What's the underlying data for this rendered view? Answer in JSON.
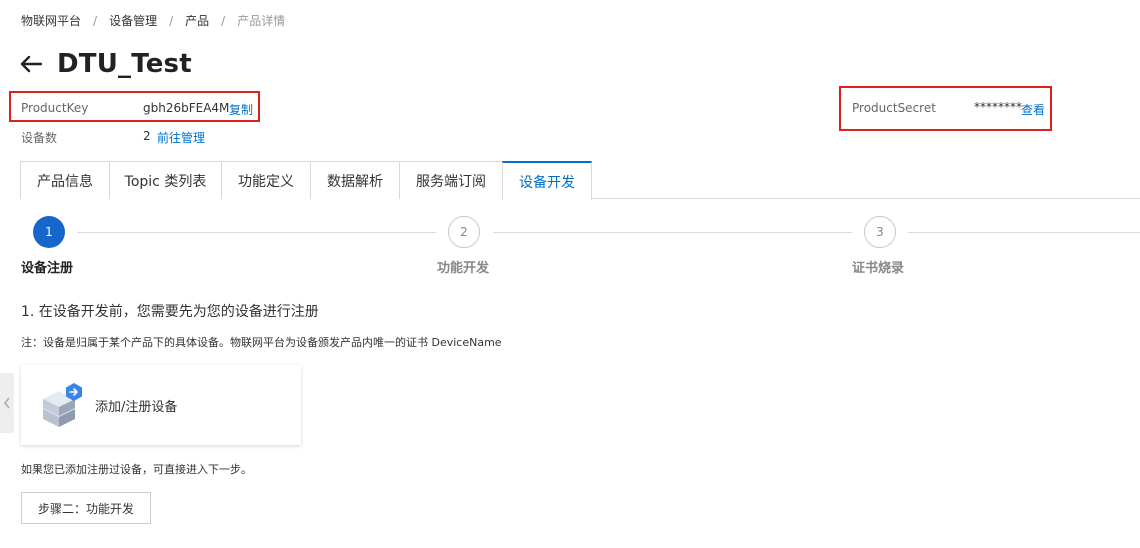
{
  "breadcrumb": {
    "items": [
      "物联网平台",
      "设备管理",
      "产品",
      "产品详情"
    ],
    "separator": "/"
  },
  "header": {
    "title": "DTU_Test",
    "back_icon": "arrow-left-icon"
  },
  "product_info": {
    "product_key_label": "ProductKey",
    "product_key_value": "gbh26bFEA4M",
    "copy_label": "复制",
    "device_count_label": "设备数",
    "device_count_value": "2",
    "manage_label": "前往管理",
    "product_secret_label": "ProductSecret",
    "product_secret_value": "********",
    "view_label": "查看"
  },
  "tabs": [
    {
      "label": "产品信息"
    },
    {
      "label": "Topic 类列表"
    },
    {
      "label": "功能定义"
    },
    {
      "label": "数据解析"
    },
    {
      "label": "服务端订阅"
    },
    {
      "label": "设备开发"
    }
  ],
  "active_tab": "设备开发",
  "steps": [
    {
      "number": "1",
      "label": "设备注册"
    },
    {
      "number": "2",
      "label": "功能开发"
    },
    {
      "number": "3",
      "label": "证书烧录"
    }
  ],
  "content": {
    "heading": "1. 在设备开发前，您需要先为您的设备进行注册",
    "note": "注：设备是归属于某个产品下的具体设备。物联网平台为设备颁发产品内唯一的证书 DeviceName",
    "add_device_label": "添加/注册设备",
    "add_device_icon": "device-box-icon",
    "hint": "如果您已添加注册过设备，可直接进入下一步。",
    "next_button_label": "步骤二：功能开发"
  },
  "colors": {
    "accent": "#0070cc",
    "step_active": "#1766c9",
    "highlight_border": "#e0201c"
  }
}
